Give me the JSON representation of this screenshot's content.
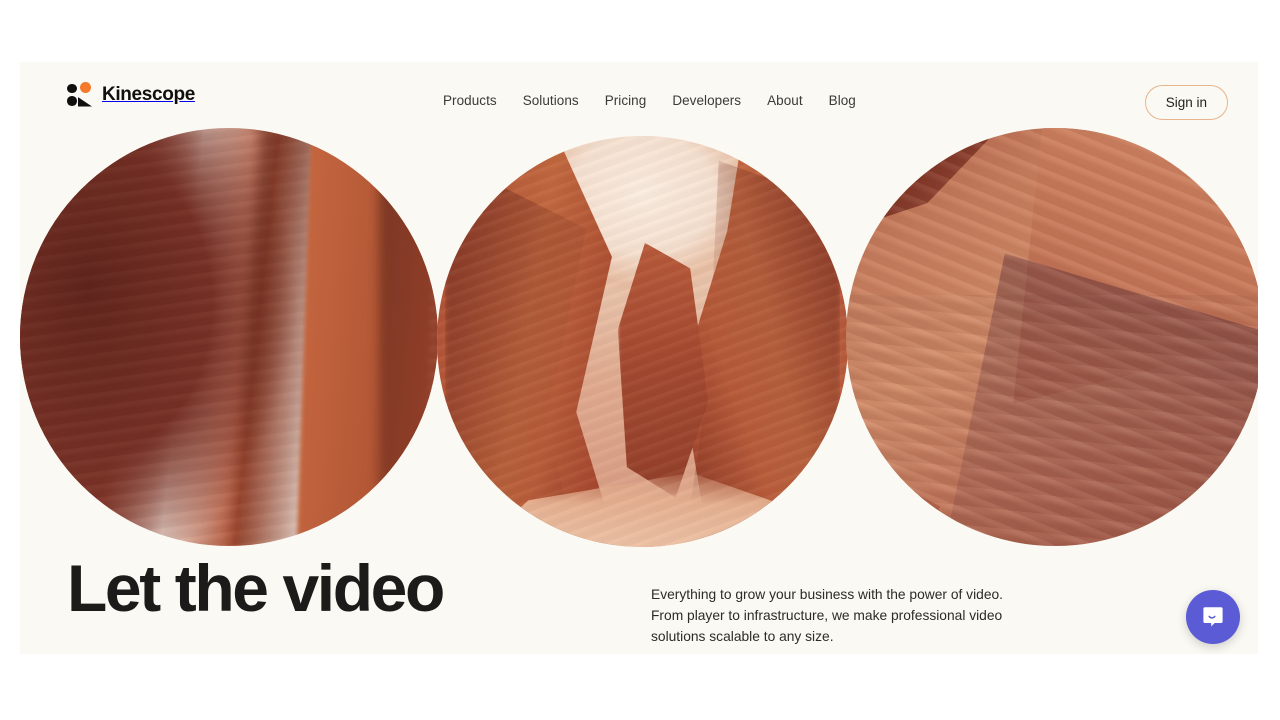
{
  "brand": {
    "name": "Kinescope",
    "logo_icon": "kinescope-logo-icon",
    "logo_colors": {
      "dot_black": "#11100f",
      "dot_orange": "#f4792b"
    }
  },
  "nav": {
    "items": [
      {
        "label": "Products"
      },
      {
        "label": "Solutions"
      },
      {
        "label": "Pricing"
      },
      {
        "label": "Developers"
      },
      {
        "label": "About"
      },
      {
        "label": "Blog"
      }
    ]
  },
  "header": {
    "sign_in_label": "Sign in",
    "sign_in_border_color": "#e8b48e"
  },
  "hero": {
    "images": [
      {
        "alt": "dark red canyon wall",
        "shape": "circle"
      },
      {
        "alt": "slot canyon with bright sky and sandy path",
        "shape": "circle"
      },
      {
        "alt": "layered red sandstone strata",
        "shape": "circle"
      }
    ],
    "headline": "Let the video",
    "lede_lines": [
      "Everything to grow your business with the power of video.",
      "From player to infrastructure, we make professional video",
      "solutions scalable to any size."
    ]
  },
  "chat": {
    "icon": "intercom-chat-icon",
    "color": "#5b5bd6"
  },
  "theme": {
    "page_background": "#ffffff",
    "site_background": "#faf9f3",
    "text_primary": "#1c1b19",
    "text_nav": "#3b3a38",
    "accent_orange": "#f4792b"
  }
}
